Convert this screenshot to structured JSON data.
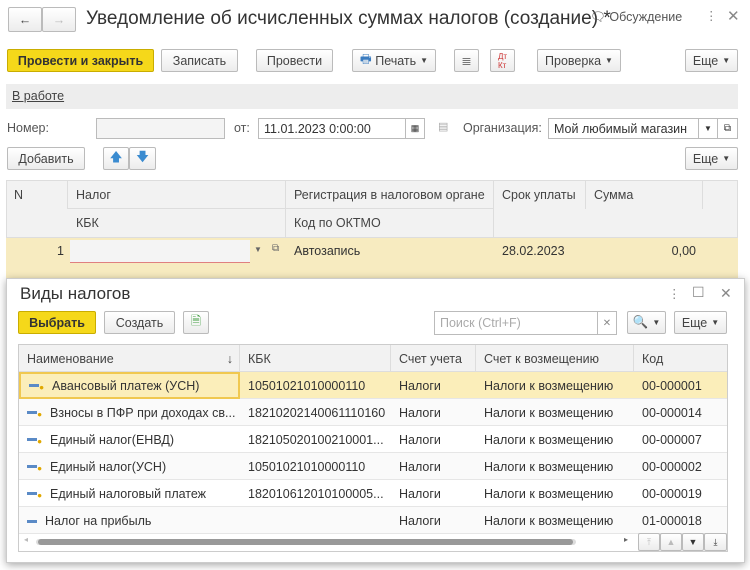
{
  "window": {
    "title": "Уведомление об исчисленных суммах налогов (создание) *",
    "discussion": "Обсуждение"
  },
  "toolbar": {
    "post_close": "Провести и закрыть",
    "save": "Записать",
    "post": "Провести",
    "print": "Печать",
    "check": "Проверка",
    "more": "Еще"
  },
  "status": "В работе",
  "form": {
    "number_label": "Номер:",
    "number_value": "",
    "from_label": "от:",
    "date_value": "11.01.2023  0:00:00",
    "org_label": "Организация:",
    "org_value": "Мой любимый магазин"
  },
  "table_toolbar": {
    "add": "Добавить",
    "more": "Еще"
  },
  "table": {
    "headers": {
      "n": "N",
      "tax": "Налог",
      "kbk": "КБК",
      "reg": "Регистрация в налоговом органе",
      "oktmo": "Код по ОКТМО",
      "due": "Срок уплаты",
      "sum": "Сумма"
    },
    "rows": [
      {
        "n": "1",
        "tax": "",
        "reg": "Автозапись",
        "due": "28.02.2023",
        "sum": "0,00"
      }
    ]
  },
  "dialog": {
    "title": "Виды налогов",
    "select": "Выбрать",
    "create": "Создать",
    "search_placeholder": "Поиск (Ctrl+F)",
    "more": "Еще",
    "headers": {
      "name": "Наименование",
      "kbk": "КБК",
      "account": "Счет учета",
      "refund": "Счет к возмещению",
      "code": "Код"
    },
    "rows": [
      {
        "name": "Авансовый платеж (УСН)",
        "kbk": "10501021010000110",
        "account": "Налоги",
        "refund": "Налоги к возмещению",
        "code": "00-000001",
        "icon": "folder-item-icon"
      },
      {
        "name": "Взносы в ПФР при доходах св...",
        "kbk": "18210202140061110160",
        "account": "Налоги",
        "refund": "Налоги к возмещению",
        "code": "00-000014",
        "icon": "folder-item-icon"
      },
      {
        "name": "Единый налог(ЕНВД)",
        "kbk": "182105020100210001...",
        "account": "Налоги",
        "refund": "Налоги к возмещению",
        "code": "00-000007",
        "icon": "folder-item-icon"
      },
      {
        "name": "Единый налог(УСН)",
        "kbk": "10501021010000110",
        "account": "Налоги",
        "refund": "Налоги к возмещению",
        "code": "00-000002",
        "icon": "folder-item-icon"
      },
      {
        "name": "Единый налоговый платеж",
        "kbk": "182010612010100005...",
        "account": "Налоги",
        "refund": "Налоги к возмещению",
        "code": "00-000019",
        "icon": "folder-item-icon"
      },
      {
        "name": "Налог на прибыль",
        "kbk": "",
        "account": "Налоги",
        "refund": "Налоги к возмещению",
        "code": "01-000018",
        "icon": "item-icon"
      }
    ]
  }
}
